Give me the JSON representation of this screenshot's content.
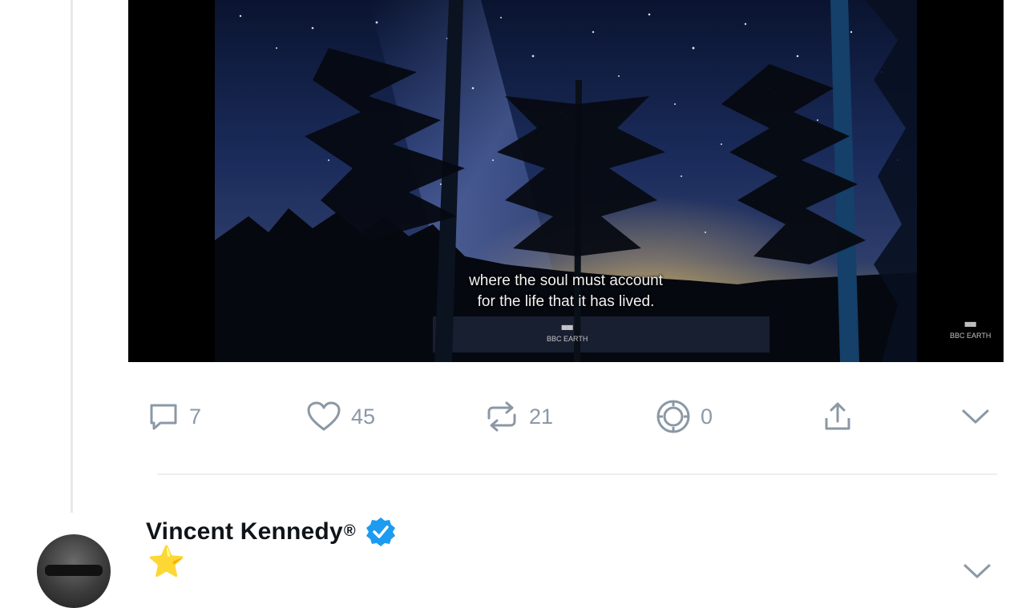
{
  "media": {
    "caption_line1": "where the soul must account",
    "caption_line2": "for the life that it has lived.",
    "watermark_main": "BBC EARTH",
    "watermark_corner": "BBC EARTH"
  },
  "actions": {
    "replies": "7",
    "likes": "45",
    "reposts": "21",
    "tips": "0"
  },
  "next_post": {
    "author_name": "Vincent Kennedy",
    "registered_mark": "®",
    "emoji": "⭐"
  },
  "colors": {
    "icon_gray": "#8b98a5",
    "verified_blue": "#1d9bf0",
    "star_gold": "#f5c518"
  },
  "icons": [
    "comment-icon",
    "heart-icon",
    "repost-icon",
    "tip-icon",
    "share-icon",
    "chevron-down-icon",
    "verified-badge-icon"
  ]
}
